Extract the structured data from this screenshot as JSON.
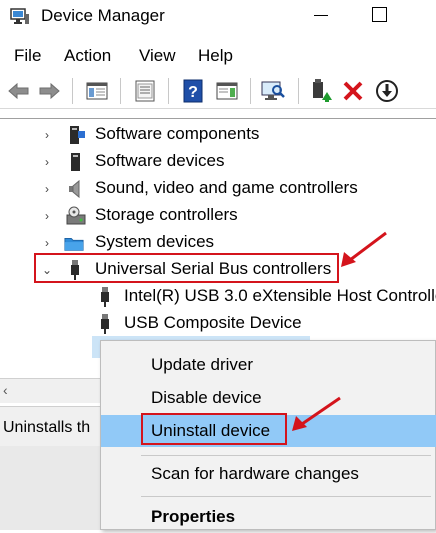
{
  "window": {
    "title": "Device Manager"
  },
  "menu": [
    "File",
    "Action",
    "View",
    "Help"
  ],
  "toolbar": {
    "icons": [
      "back-arrow-icon",
      "forward-arrow-icon",
      "show-hide-console-tree-icon",
      "properties-icon",
      "help-icon",
      "action-pane-icon",
      "scan-hardware-icon",
      "update-driver-icon",
      "uninstall-x-icon",
      "disable-device-icon"
    ]
  },
  "tree": {
    "items": [
      {
        "label": "Software components",
        "icon": "software-components-icon"
      },
      {
        "label": "Software devices",
        "icon": "software-devices-icon"
      },
      {
        "label": "Sound, video and game controllers",
        "icon": "speaker-icon"
      },
      {
        "label": "Storage controllers",
        "icon": "storage-icon"
      },
      {
        "label": "System devices",
        "icon": "folder-icon"
      },
      {
        "label": "Universal Serial Bus controllers",
        "icon": "usb-icon",
        "expanded": true
      }
    ],
    "children": [
      {
        "label": "Intel(R) USB 3.0 eXtensible Host Controlle",
        "icon": "usb-plug-icon"
      },
      {
        "label": "USB Composite Device",
        "icon": "usb-plug-icon"
      }
    ]
  },
  "status": {
    "text": "Uninstalls th"
  },
  "context_menu": {
    "items": [
      {
        "label": "Update driver"
      },
      {
        "label": "Disable device"
      },
      {
        "label": "Uninstall device",
        "highlighted": true
      },
      {
        "label": "Scan for hardware changes"
      },
      {
        "label": "Properties",
        "bold": true
      }
    ]
  },
  "colors": {
    "annotation": "#d4141c",
    "selection": "#91c9f7",
    "menu_bg": "#f2f2f2"
  }
}
